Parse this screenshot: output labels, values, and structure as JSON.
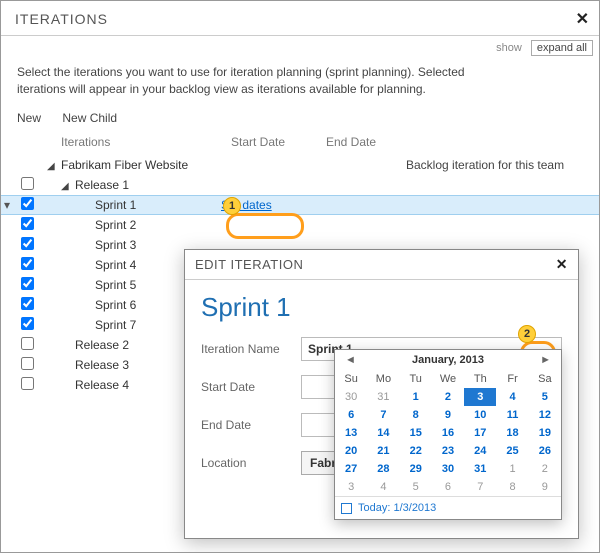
{
  "panel": {
    "title": "ITERATIONS",
    "show": "show",
    "expand_all": "expand all",
    "intro": "Select the iterations you want to use for iteration planning (sprint planning). Selected iterations will appear in your backlog view as iterations available for planning.",
    "toolbar": {
      "new": "New",
      "new_child": "New Child"
    }
  },
  "columns": {
    "iterations": "Iterations",
    "start": "Start Date",
    "end": "End Date"
  },
  "tree": {
    "root": {
      "name": "Fabrikam Fiber Website",
      "note": "Backlog iteration for this team"
    },
    "release1": "Release 1",
    "sprints": [
      "Sprint 1",
      "Sprint 2",
      "Sprint 3",
      "Sprint 4",
      "Sprint 5",
      "Sprint 6",
      "Sprint 7"
    ],
    "releases_other": [
      "Release 2",
      "Release 3",
      "Release 4"
    ],
    "set_dates": "Set dates"
  },
  "dialog": {
    "header": "EDIT ITERATION",
    "title": "Sprint 1",
    "labels": {
      "name": "Iteration Name",
      "start": "Start Date",
      "end": "End Date",
      "location": "Location"
    },
    "values": {
      "name": "Sprint 1",
      "start": "",
      "end": "",
      "location": "Fabrikam Fi..."
    }
  },
  "calendar": {
    "title": "January, 2013",
    "dow": [
      "Su",
      "Mo",
      "Tu",
      "We",
      "Th",
      "Fr",
      "Sa"
    ],
    "leading": [
      30,
      31
    ],
    "days": [
      1,
      2,
      3,
      4,
      5,
      6,
      7,
      8,
      9,
      10,
      11,
      12,
      13,
      14,
      15,
      16,
      17,
      18,
      19,
      20,
      21,
      22,
      23,
      24,
      25,
      26,
      27,
      28,
      29,
      30,
      31
    ],
    "trailing": [
      1,
      2,
      3,
      4,
      5,
      6,
      7,
      8,
      9
    ],
    "selected": 3,
    "today_label": "Today: 1/3/2013"
  },
  "badges": {
    "one": "1",
    "two": "2"
  }
}
